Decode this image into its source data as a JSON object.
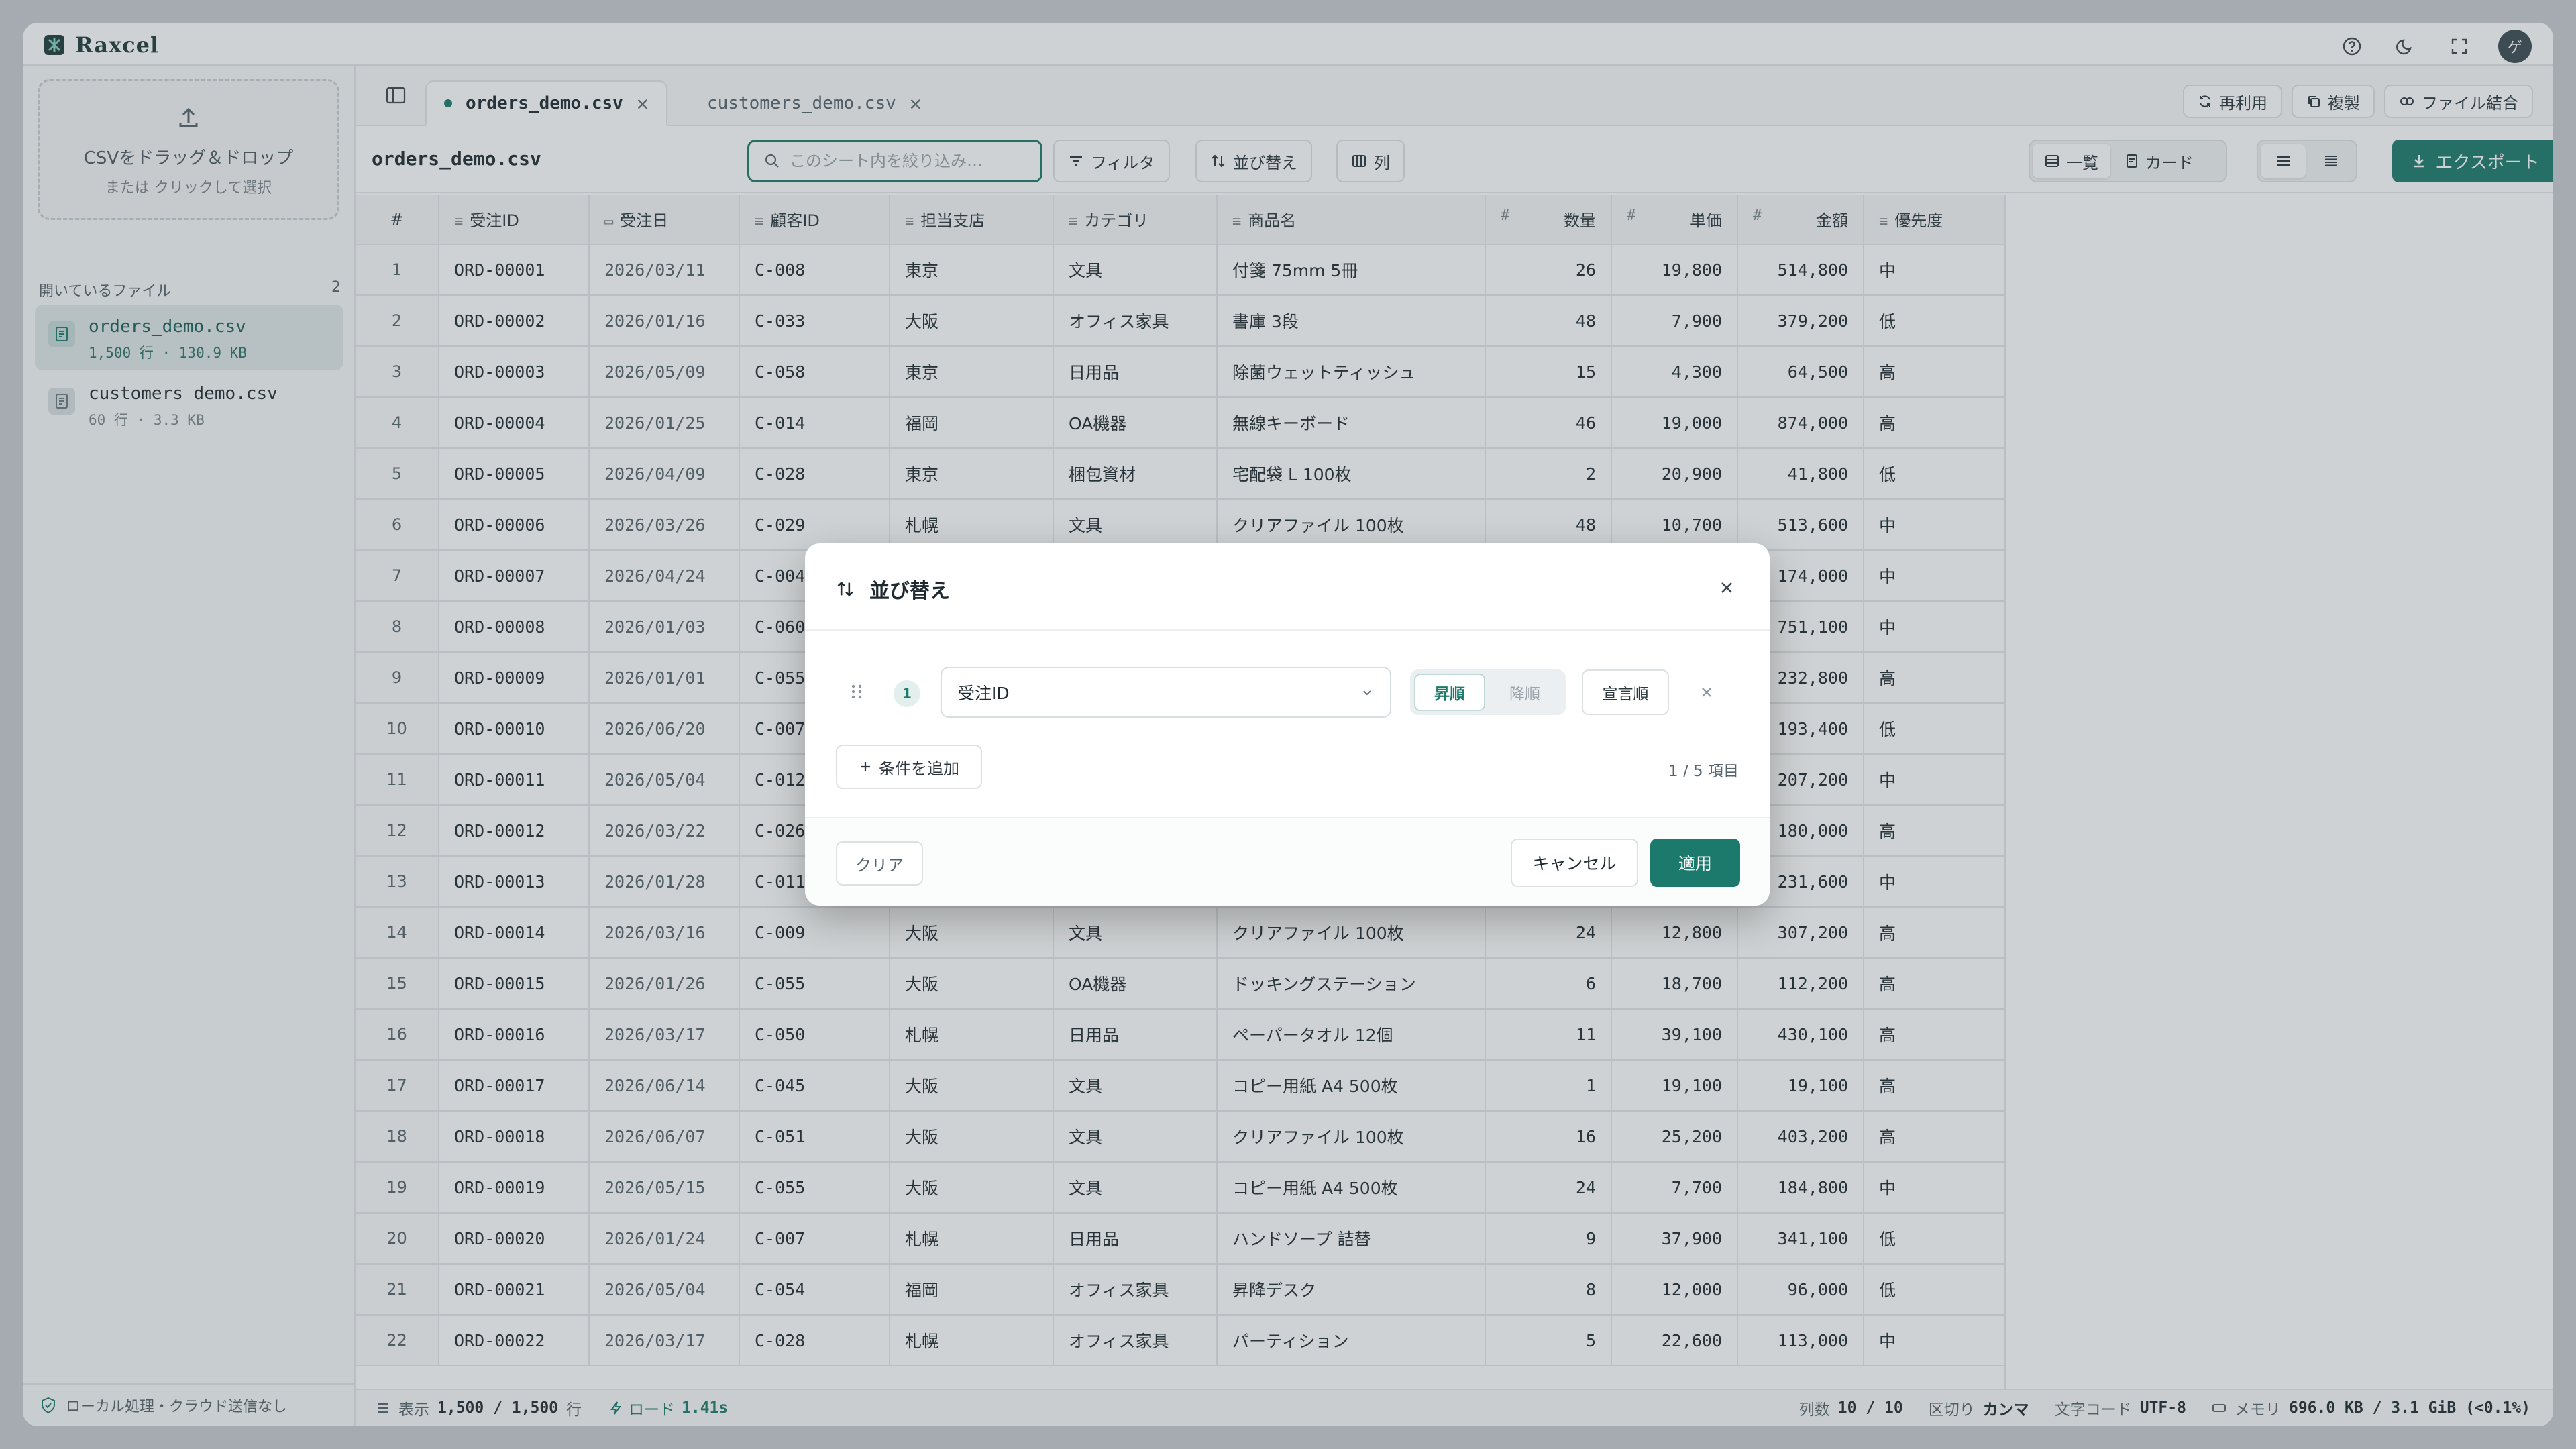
{
  "app": {
    "name": "Raxcel"
  },
  "titlebar": {
    "avatar_initial": "ゲ"
  },
  "sidebar": {
    "dropzone_title": "CSVをドラッグ＆ドロップ",
    "dropzone_sub": "または クリックして選択",
    "open_files_label": "開いているファイル",
    "open_files_count": "2",
    "files": [
      {
        "name": "orders_demo.csv",
        "meta": "1,500 行 · 130.9 KB",
        "active": true
      },
      {
        "name": "customers_demo.csv",
        "meta": "60 行 · 3.3 KB",
        "active": false
      }
    ],
    "footer": "ローカル処理・クラウド送信なし"
  },
  "tabs": [
    {
      "label": "orders_demo.csv",
      "active": true
    },
    {
      "label": "customers_demo.csv",
      "active": false
    }
  ],
  "header_actions": {
    "reuse": "再利用",
    "duplicate": "複製",
    "merge": "ファイル結合"
  },
  "toolbar": {
    "sheet_name": "orders_demo.csv",
    "search_placeholder": "このシート内を絞り込み…",
    "filter": "フィルタ",
    "sort": "並び替え",
    "columns": "列",
    "view_list": "一覧",
    "view_card": "カード",
    "export": "エクスポート"
  },
  "grid": {
    "columns": [
      {
        "label": "#",
        "icon": ""
      },
      {
        "label": "受注ID",
        "icon": "≡"
      },
      {
        "label": "受注日",
        "icon": "▭"
      },
      {
        "label": "顧客ID",
        "icon": "≡"
      },
      {
        "label": "担当支店",
        "icon": "≡"
      },
      {
        "label": "カテゴリ",
        "icon": "≡"
      },
      {
        "label": "商品名",
        "icon": "≡"
      },
      {
        "label": "数量",
        "icon": "#"
      },
      {
        "label": "単価",
        "icon": "#"
      },
      {
        "label": "金額",
        "icon": "#"
      },
      {
        "label": "優先度",
        "icon": "≡"
      }
    ],
    "rows": [
      [
        "1",
        "ORD-00001",
        "2026/03/11",
        "C-008",
        "東京",
        "文具",
        "付箋 75mm 5冊",
        "26",
        "19,800",
        "514,800",
        "中"
      ],
      [
        "2",
        "ORD-00002",
        "2026/01/16",
        "C-033",
        "大阪",
        "オフィス家具",
        "書庫 3段",
        "48",
        "7,900",
        "379,200",
        "低"
      ],
      [
        "3",
        "ORD-00003",
        "2026/05/09",
        "C-058",
        "東京",
        "日用品",
        "除菌ウェットティッシュ",
        "15",
        "4,300",
        "64,500",
        "高"
      ],
      [
        "4",
        "ORD-00004",
        "2026/01/25",
        "C-014",
        "福岡",
        "OA機器",
        "無線キーボード",
        "46",
        "19,000",
        "874,000",
        "高"
      ],
      [
        "5",
        "ORD-00005",
        "2026/04/09",
        "C-028",
        "東京",
        "梱包資材",
        "宅配袋 L 100枚",
        "2",
        "20,900",
        "41,800",
        "低"
      ],
      [
        "6",
        "ORD-00006",
        "2026/03/26",
        "C-029",
        "札幌",
        "文具",
        "クリアファイル 100枚",
        "48",
        "10,700",
        "513,600",
        "中"
      ],
      [
        "7",
        "ORD-00007",
        "2026/04/24",
        "C-004",
        "",
        "",
        "",
        "",
        "",
        "174,000",
        "中"
      ],
      [
        "8",
        "ORD-00008",
        "2026/01/03",
        "C-060",
        "",
        "",
        "",
        "",
        "",
        "751,100",
        "中"
      ],
      [
        "9",
        "ORD-00009",
        "2026/01/01",
        "C-055",
        "",
        "",
        "",
        "",
        "",
        "232,800",
        "高"
      ],
      [
        "10",
        "ORD-00010",
        "2026/06/20",
        "C-007",
        "",
        "",
        "",
        "",
        "",
        "193,400",
        "低"
      ],
      [
        "11",
        "ORD-00011",
        "2026/05/04",
        "C-012",
        "",
        "",
        "",
        "",
        "",
        "207,200",
        "中"
      ],
      [
        "12",
        "ORD-00012",
        "2026/03/22",
        "C-026",
        "",
        "",
        "",
        "",
        "",
        "180,000",
        "高"
      ],
      [
        "13",
        "ORD-00013",
        "2026/01/28",
        "C-011",
        "",
        "",
        "",
        "",
        "",
        "231,600",
        "中"
      ],
      [
        "14",
        "ORD-00014",
        "2026/03/16",
        "C-009",
        "大阪",
        "文具",
        "クリアファイル 100枚",
        "24",
        "12,800",
        "307,200",
        "高"
      ],
      [
        "15",
        "ORD-00015",
        "2026/01/26",
        "C-055",
        "大阪",
        "OA機器",
        "ドッキングステーション",
        "6",
        "18,700",
        "112,200",
        "高"
      ],
      [
        "16",
        "ORD-00016",
        "2026/03/17",
        "C-050",
        "札幌",
        "日用品",
        "ペーパータオル 12個",
        "11",
        "39,100",
        "430,100",
        "高"
      ],
      [
        "17",
        "ORD-00017",
        "2026/06/14",
        "C-045",
        "大阪",
        "文具",
        "コピー用紙 A4 500枚",
        "1",
        "19,100",
        "19,100",
        "高"
      ],
      [
        "18",
        "ORD-00018",
        "2026/06/07",
        "C-051",
        "大阪",
        "文具",
        "クリアファイル 100枚",
        "16",
        "25,200",
        "403,200",
        "高"
      ],
      [
        "19",
        "ORD-00019",
        "2026/05/15",
        "C-055",
        "大阪",
        "文具",
        "コピー用紙 A4 500枚",
        "24",
        "7,700",
        "184,800",
        "中"
      ],
      [
        "20",
        "ORD-00020",
        "2026/01/24",
        "C-007",
        "札幌",
        "日用品",
        "ハンドソープ 詰替",
        "9",
        "37,900",
        "341,100",
        "低"
      ],
      [
        "21",
        "ORD-00021",
        "2026/05/04",
        "C-054",
        "福岡",
        "オフィス家具",
        "昇降デスク",
        "8",
        "12,000",
        "96,000",
        "低"
      ],
      [
        "22",
        "ORD-00022",
        "2026/03/17",
        "C-028",
        "札幌",
        "オフィス家具",
        "パーティション",
        "5",
        "22,600",
        "113,000",
        "中"
      ]
    ]
  },
  "statusbar": {
    "display_label": "表示",
    "display_value": "1,500 / 1,500",
    "display_unit": "行",
    "load_label": "ロード",
    "load_value": "1.41s",
    "cols_label": "列数",
    "cols_value": "10 / 10",
    "delim_label": "区切り",
    "delim_value": "カンマ",
    "encoding_label": "文字コード",
    "encoding_value": "UTF-8",
    "memory_label": "メモリ",
    "memory_value": "696.0 KB / 3.1 GiB (<0.1%)"
  },
  "sort_dialog": {
    "title": "並び替え",
    "rule_number": "1",
    "field": "受注ID",
    "asc": "昇順",
    "desc": "降順",
    "declared_order": "宣言順",
    "add_condition": "条件を追加",
    "count": "1 / 5 項目",
    "clear": "クリア",
    "cancel": "キャンセル",
    "apply": "適用"
  },
  "colors": {
    "accent": "#1b7a6b",
    "border": "#e3e6e8"
  }
}
